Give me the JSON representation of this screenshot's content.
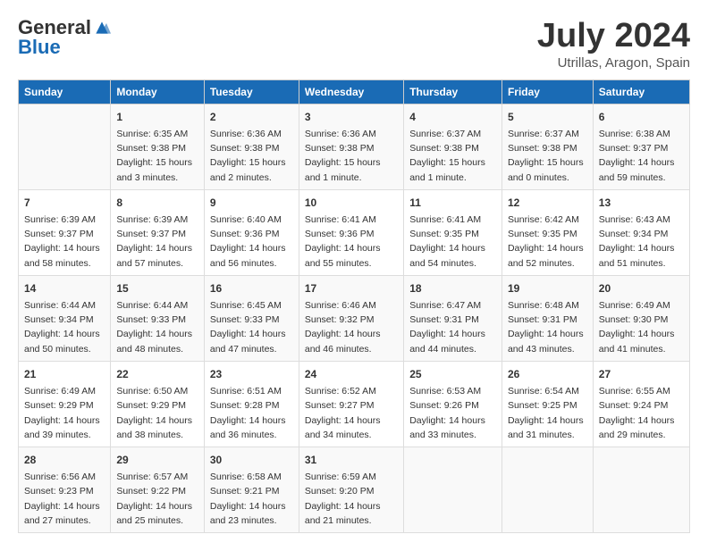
{
  "logo": {
    "general": "General",
    "blue": "Blue"
  },
  "title": {
    "month_year": "July 2024",
    "location": "Utrillas, Aragon, Spain"
  },
  "days_of_week": [
    "Sunday",
    "Monday",
    "Tuesday",
    "Wednesday",
    "Thursday",
    "Friday",
    "Saturday"
  ],
  "weeks": [
    [
      {
        "day": "",
        "sunrise": "",
        "sunset": "",
        "daylight": ""
      },
      {
        "day": "1",
        "sunrise": "Sunrise: 6:35 AM",
        "sunset": "Sunset: 9:38 PM",
        "daylight": "Daylight: 15 hours and 3 minutes."
      },
      {
        "day": "2",
        "sunrise": "Sunrise: 6:36 AM",
        "sunset": "Sunset: 9:38 PM",
        "daylight": "Daylight: 15 hours and 2 minutes."
      },
      {
        "day": "3",
        "sunrise": "Sunrise: 6:36 AM",
        "sunset": "Sunset: 9:38 PM",
        "daylight": "Daylight: 15 hours and 1 minute."
      },
      {
        "day": "4",
        "sunrise": "Sunrise: 6:37 AM",
        "sunset": "Sunset: 9:38 PM",
        "daylight": "Daylight: 15 hours and 1 minute."
      },
      {
        "day": "5",
        "sunrise": "Sunrise: 6:37 AM",
        "sunset": "Sunset: 9:38 PM",
        "daylight": "Daylight: 15 hours and 0 minutes."
      },
      {
        "day": "6",
        "sunrise": "Sunrise: 6:38 AM",
        "sunset": "Sunset: 9:37 PM",
        "daylight": "Daylight: 14 hours and 59 minutes."
      }
    ],
    [
      {
        "day": "7",
        "sunrise": "Sunrise: 6:39 AM",
        "sunset": "Sunset: 9:37 PM",
        "daylight": "Daylight: 14 hours and 58 minutes."
      },
      {
        "day": "8",
        "sunrise": "Sunrise: 6:39 AM",
        "sunset": "Sunset: 9:37 PM",
        "daylight": "Daylight: 14 hours and 57 minutes."
      },
      {
        "day": "9",
        "sunrise": "Sunrise: 6:40 AM",
        "sunset": "Sunset: 9:36 PM",
        "daylight": "Daylight: 14 hours and 56 minutes."
      },
      {
        "day": "10",
        "sunrise": "Sunrise: 6:41 AM",
        "sunset": "Sunset: 9:36 PM",
        "daylight": "Daylight: 14 hours and 55 minutes."
      },
      {
        "day": "11",
        "sunrise": "Sunrise: 6:41 AM",
        "sunset": "Sunset: 9:35 PM",
        "daylight": "Daylight: 14 hours and 54 minutes."
      },
      {
        "day": "12",
        "sunrise": "Sunrise: 6:42 AM",
        "sunset": "Sunset: 9:35 PM",
        "daylight": "Daylight: 14 hours and 52 minutes."
      },
      {
        "day": "13",
        "sunrise": "Sunrise: 6:43 AM",
        "sunset": "Sunset: 9:34 PM",
        "daylight": "Daylight: 14 hours and 51 minutes."
      }
    ],
    [
      {
        "day": "14",
        "sunrise": "Sunrise: 6:44 AM",
        "sunset": "Sunset: 9:34 PM",
        "daylight": "Daylight: 14 hours and 50 minutes."
      },
      {
        "day": "15",
        "sunrise": "Sunrise: 6:44 AM",
        "sunset": "Sunset: 9:33 PM",
        "daylight": "Daylight: 14 hours and 48 minutes."
      },
      {
        "day": "16",
        "sunrise": "Sunrise: 6:45 AM",
        "sunset": "Sunset: 9:33 PM",
        "daylight": "Daylight: 14 hours and 47 minutes."
      },
      {
        "day": "17",
        "sunrise": "Sunrise: 6:46 AM",
        "sunset": "Sunset: 9:32 PM",
        "daylight": "Daylight: 14 hours and 46 minutes."
      },
      {
        "day": "18",
        "sunrise": "Sunrise: 6:47 AM",
        "sunset": "Sunset: 9:31 PM",
        "daylight": "Daylight: 14 hours and 44 minutes."
      },
      {
        "day": "19",
        "sunrise": "Sunrise: 6:48 AM",
        "sunset": "Sunset: 9:31 PM",
        "daylight": "Daylight: 14 hours and 43 minutes."
      },
      {
        "day": "20",
        "sunrise": "Sunrise: 6:49 AM",
        "sunset": "Sunset: 9:30 PM",
        "daylight": "Daylight: 14 hours and 41 minutes."
      }
    ],
    [
      {
        "day": "21",
        "sunrise": "Sunrise: 6:49 AM",
        "sunset": "Sunset: 9:29 PM",
        "daylight": "Daylight: 14 hours and 39 minutes."
      },
      {
        "day": "22",
        "sunrise": "Sunrise: 6:50 AM",
        "sunset": "Sunset: 9:29 PM",
        "daylight": "Daylight: 14 hours and 38 minutes."
      },
      {
        "day": "23",
        "sunrise": "Sunrise: 6:51 AM",
        "sunset": "Sunset: 9:28 PM",
        "daylight": "Daylight: 14 hours and 36 minutes."
      },
      {
        "day": "24",
        "sunrise": "Sunrise: 6:52 AM",
        "sunset": "Sunset: 9:27 PM",
        "daylight": "Daylight: 14 hours and 34 minutes."
      },
      {
        "day": "25",
        "sunrise": "Sunrise: 6:53 AM",
        "sunset": "Sunset: 9:26 PM",
        "daylight": "Daylight: 14 hours and 33 minutes."
      },
      {
        "day": "26",
        "sunrise": "Sunrise: 6:54 AM",
        "sunset": "Sunset: 9:25 PM",
        "daylight": "Daylight: 14 hours and 31 minutes."
      },
      {
        "day": "27",
        "sunrise": "Sunrise: 6:55 AM",
        "sunset": "Sunset: 9:24 PM",
        "daylight": "Daylight: 14 hours and 29 minutes."
      }
    ],
    [
      {
        "day": "28",
        "sunrise": "Sunrise: 6:56 AM",
        "sunset": "Sunset: 9:23 PM",
        "daylight": "Daylight: 14 hours and 27 minutes."
      },
      {
        "day": "29",
        "sunrise": "Sunrise: 6:57 AM",
        "sunset": "Sunset: 9:22 PM",
        "daylight": "Daylight: 14 hours and 25 minutes."
      },
      {
        "day": "30",
        "sunrise": "Sunrise: 6:58 AM",
        "sunset": "Sunset: 9:21 PM",
        "daylight": "Daylight: 14 hours and 23 minutes."
      },
      {
        "day": "31",
        "sunrise": "Sunrise: 6:59 AM",
        "sunset": "Sunset: 9:20 PM",
        "daylight": "Daylight: 14 hours and 21 minutes."
      },
      {
        "day": "",
        "sunrise": "",
        "sunset": "",
        "daylight": ""
      },
      {
        "day": "",
        "sunrise": "",
        "sunset": "",
        "daylight": ""
      },
      {
        "day": "",
        "sunrise": "",
        "sunset": "",
        "daylight": ""
      }
    ]
  ]
}
